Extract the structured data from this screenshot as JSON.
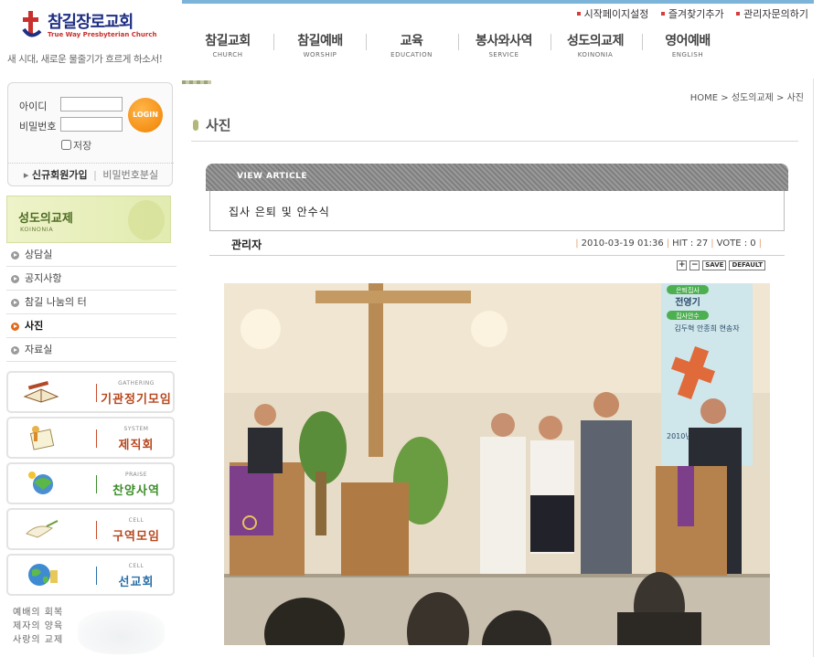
{
  "site": {
    "name": "참길장로교회",
    "name_en": "True Way Presbyterian Church",
    "slogan": "새 시대, 새로운 물줄기가 흐르게 하소서!"
  },
  "login": {
    "id_label": "아이디",
    "pw_label": "비밀번호",
    "button": "LOGIN",
    "save_label": "저장",
    "join_link": "신규회원가입",
    "find_pw_link": "비밀번호분실"
  },
  "utility_links": [
    "시작페이지설정",
    "즐겨찾기추가",
    "관리자문의하기"
  ],
  "gnb": [
    {
      "ko": "참길교회",
      "en": "CHURCH"
    },
    {
      "ko": "참길예배",
      "en": "WORSHIP"
    },
    {
      "ko": "교육",
      "en": "EDUCATION"
    },
    {
      "ko": "봉사와사역",
      "en": "SERVICE"
    },
    {
      "ko": "성도의교제",
      "en": "KOINONIA"
    },
    {
      "ko": "영어예배",
      "en": "ENGLISH"
    }
  ],
  "section": {
    "ko": "성도의교제",
    "en": "KOINONIA"
  },
  "left_menu": [
    {
      "label": "상담실",
      "active": false
    },
    {
      "label": "공지사항",
      "active": false
    },
    {
      "label": "참길 나눔의 터",
      "active": false
    },
    {
      "label": "사진",
      "active": true
    },
    {
      "label": "자료실",
      "active": false
    }
  ],
  "side_banners": [
    {
      "en": "GATHERING",
      "ko": "기관정기모임",
      "icon": "bible-icon"
    },
    {
      "en": "SYSTEM",
      "ko": "제직회",
      "icon": "document-icon"
    },
    {
      "en": "PRAISE",
      "ko": "찬양사역",
      "icon": "music-icon"
    },
    {
      "en": "CELL",
      "ko": "구역모임",
      "icon": "dove-icon"
    },
    {
      "en": "CELL",
      "ko": "선교회",
      "icon": "globe-icon"
    }
  ],
  "left_footer": [
    "예배의 회복",
    "제자의 양육",
    "사랑의 교제"
  ],
  "breadcrumb": "HOME > 성도의교제 > 사진",
  "page_title": "사진",
  "article": {
    "header": "VIEW ARTICLE",
    "title": "집사 은퇴 및 안수식",
    "author": "관리자",
    "date": "2010-03-19 01:36",
    "hit_label": "HIT : 27",
    "vote_label": "VOTE : 0",
    "tools": [
      "+",
      "−",
      "SAVE",
      "DEFAULT"
    ]
  },
  "photo_banner_text": {
    "line1": "은퇴집사",
    "line2": "전영기",
    "line3": "집사안수",
    "line4": "김두혁 안종희 현송자",
    "date_fragment": "2010년"
  },
  "colors": {
    "nav_accent": "#7cb3d9",
    "active_dot": "#e26a1a",
    "section_green": "#4d6b22"
  }
}
